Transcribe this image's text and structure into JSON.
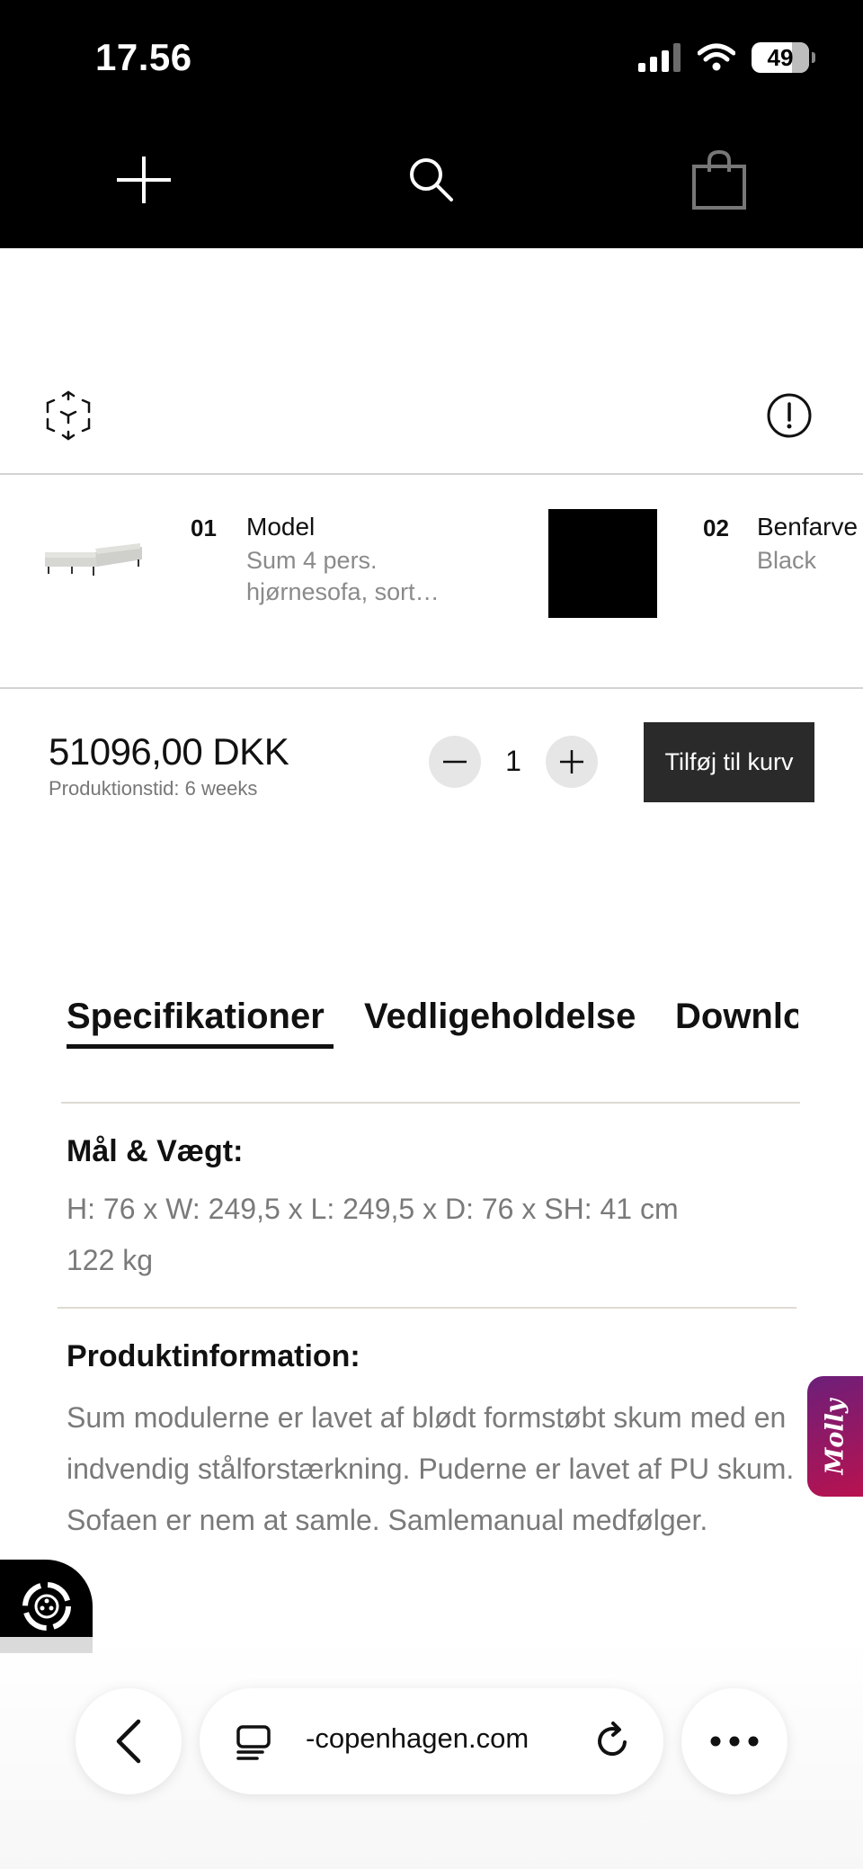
{
  "status_bar": {
    "time": "17.56",
    "battery": "49"
  },
  "config": {
    "items": [
      {
        "number": "01",
        "title": "Model",
        "subtitle_line1": "Sum 4 pers.",
        "subtitle_line2": "hjørnesofa, sort…"
      },
      {
        "number": "02",
        "title": "Benfarve",
        "subtitle": "Black"
      }
    ],
    "swatch_color": "#000000"
  },
  "purchase": {
    "price": "51096,00 DKK",
    "lead_time": "Produktionstid: 6 weeks",
    "quantity": "1",
    "add_to_cart_label": "Tilføj til kurv"
  },
  "tabs": [
    {
      "label": "Specifikationer",
      "active": true
    },
    {
      "label": "Vedligeholdelse",
      "active": false
    },
    {
      "label": "Downloads",
      "active": false
    }
  ],
  "specs": {
    "dimensions_title": "Mål & Vægt:",
    "dimensions_line1": "H: 76 x W: 249,5 x L: 249,5 x D: 76 x SH: 41 cm",
    "dimensions_line2": "122 kg",
    "info_title": "Produktinformation:",
    "info_text": "Sum modulerne er lavet af blødt formstøbt skum med en indvendig stålforstærkning. Puderne er lavet af PU skum. Sofaen er nem at samle. Samlemanual medfølger."
  },
  "chat_widget": {
    "label": "Molly"
  },
  "browser": {
    "url": "-copenhagen.com"
  },
  "colors": {
    "header_bg": "#000000",
    "button_bg": "#2a2a2a",
    "molly_start": "#6c1f7a",
    "molly_end": "#b8124f"
  }
}
